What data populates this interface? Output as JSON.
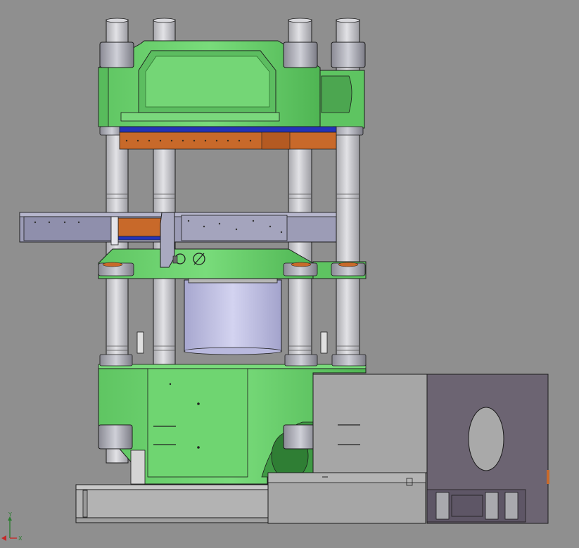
{
  "viewport": {
    "background": "#8f8f8f",
    "axis_triad": {
      "y_label": "Y",
      "x_label": "X"
    }
  },
  "colors": {
    "frame_green": "#6cd16e",
    "frame_green_dark": "#3f9a44",
    "column_grey": "#c9c9cd",
    "mould_orange": "#c8692a",
    "insulation_blue": "#2433b8",
    "cylinder_lavender": "#c4c4e6",
    "cabinet_grey": "#a6a6a6",
    "cabinet_purple": "#6c6472",
    "outline": "#1c1c1c"
  }
}
